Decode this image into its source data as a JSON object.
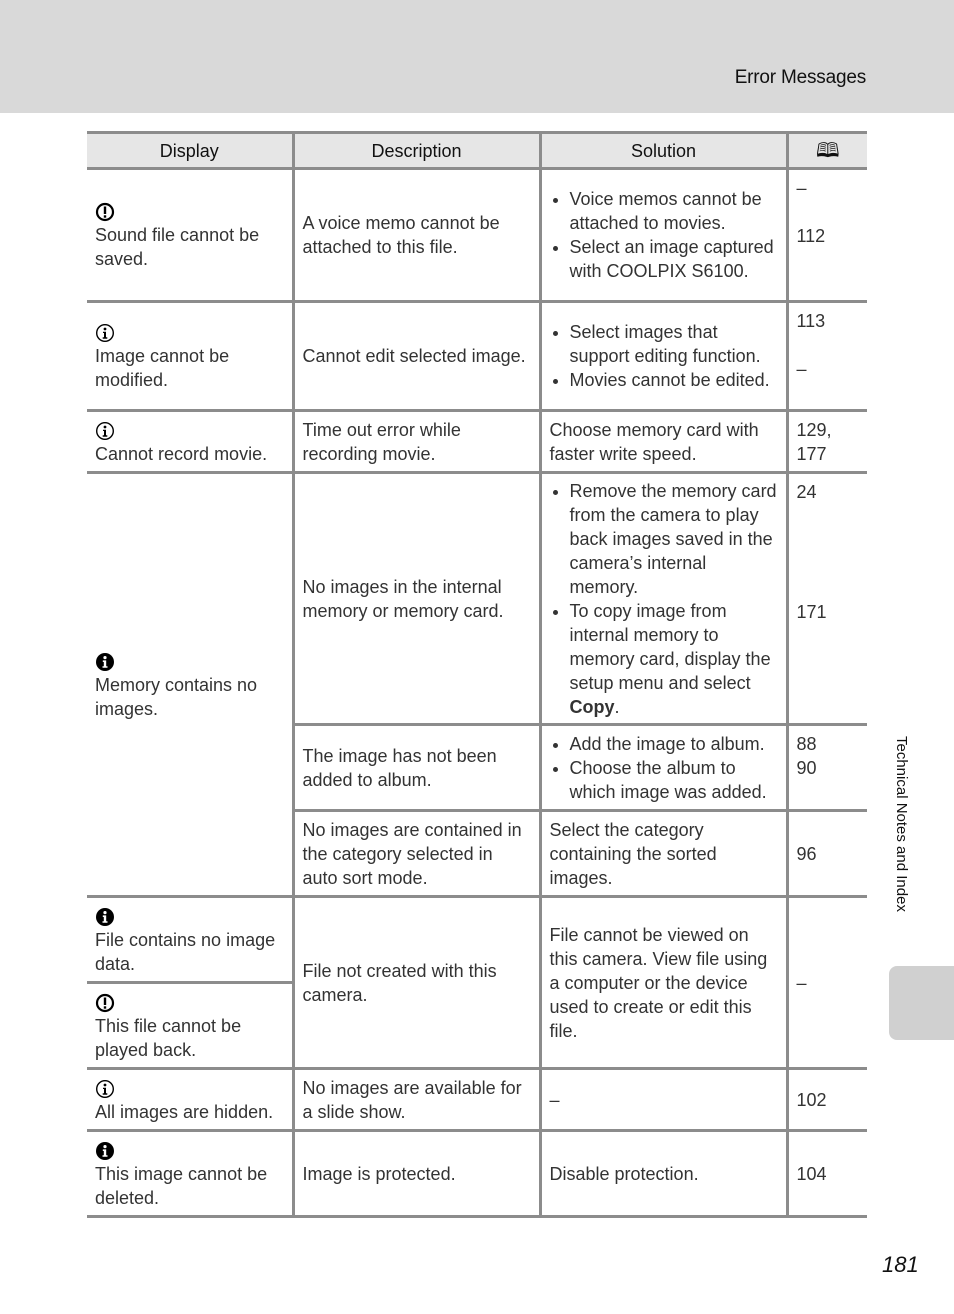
{
  "header": {
    "title": "Error Messages"
  },
  "side_tab": {
    "label": "Technical Notes and Index"
  },
  "page_number": "181",
  "table": {
    "columns": [
      "Display",
      "Description",
      "Solution",
      "book-reference-icon"
    ],
    "rows": [
      {
        "icon": "warning-icon",
        "display": "Sound file cannot be saved.",
        "description": "A voice memo cannot be attached to this file.",
        "solutions": [
          "Voice memos cannot be attached to movies.",
          "Select an image captured with COOLPIX S6100."
        ],
        "pages": [
          "–",
          "112"
        ]
      },
      {
        "icon": "info-outline-icon",
        "display": "Image cannot be modified.",
        "description": "Cannot edit selected image.",
        "solutions": [
          "Select images that support editing function.",
          "Movies cannot be edited."
        ],
        "pages": [
          "113",
          "–"
        ]
      },
      {
        "icon": "info-outline-icon",
        "display": "Cannot record movie.",
        "description": "Time out error while recording movie.",
        "solution_text": "Choose memory card with faster write speed.",
        "pages": [
          "129,\n177"
        ]
      },
      {
        "icon": "info-filled-icon",
        "display": "Memory contains no images.",
        "sub": [
          {
            "description": "No images in the internal memory or memory card.",
            "solutions": [
              "Remove the memory card from the camera to play back images saved in the camera’s internal memory.",
              "To copy image from internal memory to memory card, display the setup menu and select "
            ],
            "bold": "Copy",
            "pages": [
              "24",
              "171"
            ]
          },
          {
            "description": "The image has not been added to album.",
            "solutions": [
              "Add the image to album.",
              "Choose the album to which image was added."
            ],
            "pages": [
              "88\n90"
            ]
          },
          {
            "description": "No images are contained in the category selected in auto sort mode.",
            "solution_text": "Select the category containing the sorted images.",
            "pages": [
              "96"
            ]
          }
        ]
      },
      {
        "icon": "info-filled-icon",
        "display": "File contains no image data.",
        "description": "File not created with this camera.",
        "solution_text": "File cannot be viewed on this camera. View file using a computer or the device used to create or edit this file.",
        "pages": [
          "–"
        ]
      },
      {
        "icon": "warning-icon",
        "display": "This file cannot be played back."
      },
      {
        "icon": "info-outline-icon",
        "display": "All images are hidden.",
        "description": "No images are available for a slide show.",
        "solution_text": "–",
        "pages": [
          "102"
        ]
      },
      {
        "icon": "info-filled-icon",
        "display": "This image cannot be deleted.",
        "description": "Image is protected.",
        "solution_text": "Disable protection.",
        "pages": [
          "104"
        ]
      }
    ]
  }
}
